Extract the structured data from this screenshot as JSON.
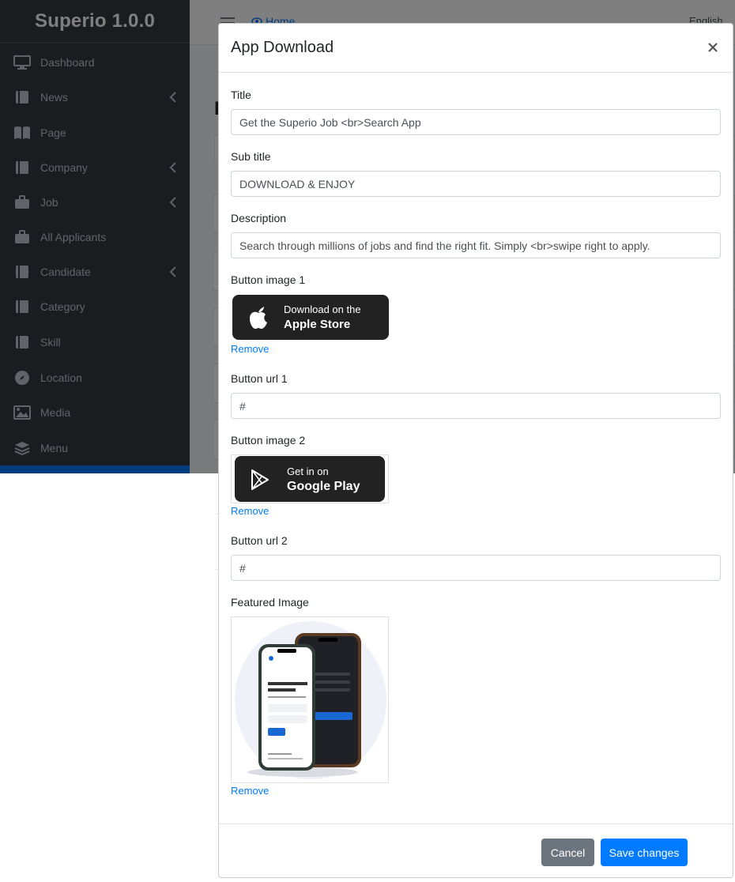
{
  "app": {
    "brand": "Superio 1.0.0"
  },
  "sidebar": {
    "items": [
      {
        "label": "Dashboard",
        "icon": "monitor-icon",
        "has_caret": false
      },
      {
        "label": "News",
        "icon": "book-icon",
        "has_caret": true
      },
      {
        "label": "Page",
        "icon": "book-open-icon",
        "has_caret": false
      },
      {
        "label": "Company",
        "icon": "book-icon",
        "has_caret": true
      },
      {
        "label": "Job",
        "icon": "briefcase-icon",
        "has_caret": true
      },
      {
        "label": "All Applicants",
        "icon": "briefcase-icon",
        "has_caret": false
      },
      {
        "label": "Candidate",
        "icon": "book-icon",
        "has_caret": true
      },
      {
        "label": "Category",
        "icon": "book-icon",
        "has_caret": false
      },
      {
        "label": "Skill",
        "icon": "book-icon",
        "has_caret": false
      },
      {
        "label": "Location",
        "icon": "compass-icon",
        "has_caret": false
      },
      {
        "label": "Media",
        "icon": "image-icon",
        "has_caret": false
      },
      {
        "label": "Menu",
        "icon": "layers-icon",
        "has_caret": false
      }
    ]
  },
  "topbar": {
    "home_label": "Home",
    "language": "English"
  },
  "modal": {
    "title": "App Download",
    "fields": {
      "title_label": "Title",
      "title_value": "Get the Superio Job <br>Search App",
      "subtitle_label": "Sub title",
      "subtitle_value": "DOWNLOAD & ENJOY",
      "description_label": "Description",
      "description_value": "Search through millions of jobs and find the right fit. Simply <br>swipe right to apply.",
      "button_image_1_label": "Button image 1",
      "button_url_1_label": "Button url 1",
      "button_url_1_value": "#",
      "button_image_2_label": "Button image 2",
      "button_url_2_label": "Button url 2",
      "button_url_2_value": "#",
      "featured_image_label": "Featured Image"
    },
    "badges": {
      "apple_line1": "Download on the",
      "apple_line2": "Apple Store",
      "google_line1": "Get in on",
      "google_line2": "Google Play"
    },
    "remove_label": "Remove",
    "cancel_label": "Cancel",
    "save_label": "Save changes"
  },
  "colors": {
    "sidebar_bg": "#343a40",
    "primary": "#007bff",
    "secondary": "#6c757d",
    "badge_bg": "#222222"
  }
}
